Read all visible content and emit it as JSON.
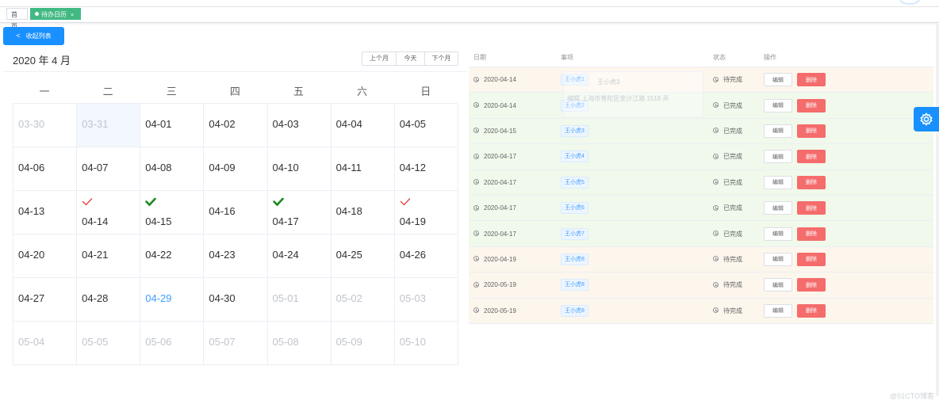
{
  "tabs": {
    "home": "首页",
    "active": "待办日历",
    "close": "×"
  },
  "collapse_button": "收起列表",
  "calendar": {
    "title": "2020 年 4 月",
    "prev": "上个月",
    "today": "今天",
    "next": "下个月",
    "weekdays": [
      "一",
      "二",
      "三",
      "四",
      "五",
      "六",
      "日"
    ],
    "weeks": [
      [
        {
          "d": "03-30",
          "other": true
        },
        {
          "d": "03-31",
          "other": true,
          "sel": true
        },
        {
          "d": "04-01"
        },
        {
          "d": "04-02"
        },
        {
          "d": "04-03"
        },
        {
          "d": "04-04"
        },
        {
          "d": "04-05"
        }
      ],
      [
        {
          "d": "04-06"
        },
        {
          "d": "04-07"
        },
        {
          "d": "04-08"
        },
        {
          "d": "04-09"
        },
        {
          "d": "04-10"
        },
        {
          "d": "04-11"
        },
        {
          "d": "04-12"
        }
      ],
      [
        {
          "d": "04-13"
        },
        {
          "d": "04-14",
          "mark": "pending"
        },
        {
          "d": "04-15",
          "mark": "done"
        },
        {
          "d": "04-16"
        },
        {
          "d": "04-17",
          "mark": "done"
        },
        {
          "d": "04-18"
        },
        {
          "d": "04-19",
          "mark": "pending"
        }
      ],
      [
        {
          "d": "04-20"
        },
        {
          "d": "04-21"
        },
        {
          "d": "04-22"
        },
        {
          "d": "04-23"
        },
        {
          "d": "04-24"
        },
        {
          "d": "04-25"
        },
        {
          "d": "04-26"
        }
      ],
      [
        {
          "d": "04-27"
        },
        {
          "d": "04-28"
        },
        {
          "d": "04-29",
          "today": true
        },
        {
          "d": "04-30"
        },
        {
          "d": "05-01",
          "other": true
        },
        {
          "d": "05-02",
          "other": true
        },
        {
          "d": "05-03",
          "other": true
        }
      ],
      [
        {
          "d": "05-04",
          "other": true
        },
        {
          "d": "05-05",
          "other": true
        },
        {
          "d": "05-06",
          "other": true
        },
        {
          "d": "05-07",
          "other": true
        },
        {
          "d": "05-08",
          "other": true
        },
        {
          "d": "05-09",
          "other": true
        },
        {
          "d": "05-10",
          "other": true
        }
      ]
    ]
  },
  "table": {
    "headers": {
      "date": "日期",
      "item": "事项",
      "status": "状态",
      "ops": "操作"
    },
    "edit_label": "编辑",
    "delete_label": "删除",
    "rows": [
      {
        "date": "2020-04-14",
        "name": "王小虎1",
        "status": "待完成",
        "state": "pending"
      },
      {
        "date": "2020-04-14",
        "name": "王小虎2",
        "status": "已完成",
        "state": "done"
      },
      {
        "date": "2020-04-15",
        "name": "王小虎3",
        "status": "已完成",
        "state": "done"
      },
      {
        "date": "2020-04-17",
        "name": "王小虎4",
        "status": "已完成",
        "state": "done"
      },
      {
        "date": "2020-04-17",
        "name": "王小虎5",
        "status": "已完成",
        "state": "done"
      },
      {
        "date": "2020-04-17",
        "name": "王小虎6",
        "status": "已完成",
        "state": "done"
      },
      {
        "date": "2020-04-17",
        "name": "王小虎7",
        "status": "已完成",
        "state": "done"
      },
      {
        "date": "2020-04-19",
        "name": "王小虎8",
        "status": "待完成",
        "state": "pending"
      },
      {
        "date": "2020-05-19",
        "name": "王小虎8",
        "status": "待完成",
        "state": "pending"
      },
      {
        "date": "2020-05-19",
        "name": "王小虎8",
        "status": "待完成",
        "state": "pending"
      }
    ]
  },
  "tooltip": {
    "name": "王小虎3",
    "address": "编辑 上海市普陀区金沙江路 1518 弄"
  },
  "watermark": "@51CTO博客",
  "colors": {
    "primary": "#1890ff",
    "tab_active": "#42b983",
    "pending_bg": "#fdf6ec",
    "done_bg": "#f0f9eb",
    "delete": "#f56c6c",
    "pending_mark": "#e53935",
    "done_mark": "#1b8a1b"
  },
  "icons": {
    "collapse": "chevron-left-icon",
    "clock": "clock-icon",
    "settings": "gear-icon",
    "pending_mark": "checkmark-outline-icon",
    "done_mark": "checkmark-bold-icon"
  }
}
